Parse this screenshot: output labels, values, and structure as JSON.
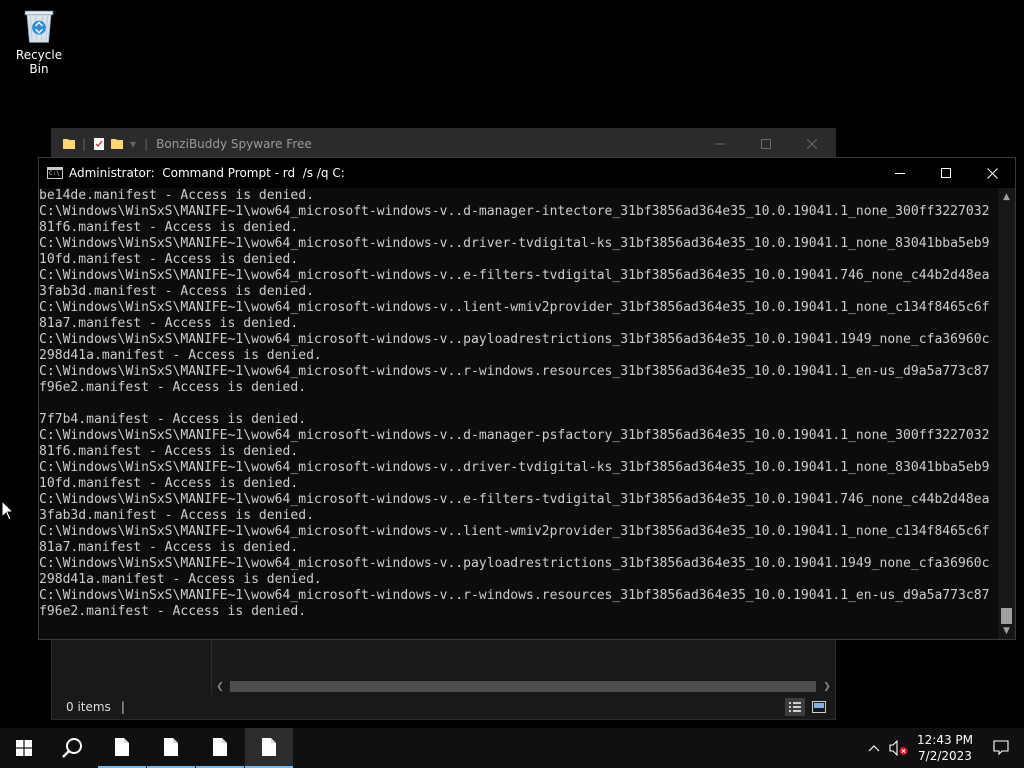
{
  "desktop": {
    "recycle_bin_label": "Recycle Bin"
  },
  "explorer": {
    "title": "BonziBuddy Spyware Free",
    "status_items": "0 items",
    "status_cursor": "|"
  },
  "cmd": {
    "title": "Administrator:  Command Prompt - rd  /s /q C:",
    "lines": [
      "be14de.manifest - Access is denied.",
      "C:\\Windows\\WinSxS\\MANIFE~1\\wow64_microsoft-windows-v..d-manager-intectore_31bf3856ad364e35_10.0.19041.1_none_300ff3227032",
      "81f6.manifest - Access is denied.",
      "C:\\Windows\\WinSxS\\MANIFE~1\\wow64_microsoft-windows-v..driver-tvdigital-ks_31bf3856ad364e35_10.0.19041.1_none_83041bba5eb9",
      "10fd.manifest - Access is denied.",
      "C:\\Windows\\WinSxS\\MANIFE~1\\wow64_microsoft-windows-v..e-filters-tvdigital_31bf3856ad364e35_10.0.19041.746_none_c44b2d48ea",
      "3fab3d.manifest - Access is denied.",
      "C:\\Windows\\WinSxS\\MANIFE~1\\wow64_microsoft-windows-v..lient-wmiv2provider_31bf3856ad364e35_10.0.19041.1_none_c134f8465c6f",
      "81a7.manifest - Access is denied.",
      "C:\\Windows\\WinSxS\\MANIFE~1\\wow64_microsoft-windows-v..payloadrestrictions_31bf3856ad364e35_10.0.19041.1949_none_cfa36960c",
      "298d41a.manifest - Access is denied.",
      "C:\\Windows\\WinSxS\\MANIFE~1\\wow64_microsoft-windows-v..r-windows.resources_31bf3856ad364e35_10.0.19041.1_en-us_d9a5a773c87",
      "f96e2.manifest - Access is denied.",
      "",
      "7f7b4.manifest - Access is denied.",
      "C:\\Windows\\WinSxS\\MANIFE~1\\wow64_microsoft-windows-v..d-manager-psfactory_31bf3856ad364e35_10.0.19041.1_none_300ff3227032",
      "81f6.manifest - Access is denied.",
      "C:\\Windows\\WinSxS\\MANIFE~1\\wow64_microsoft-windows-v..driver-tvdigital-ks_31bf3856ad364e35_10.0.19041.1_none_83041bba5eb9",
      "10fd.manifest - Access is denied.",
      "C:\\Windows\\WinSxS\\MANIFE~1\\wow64_microsoft-windows-v..e-filters-tvdigital_31bf3856ad364e35_10.0.19041.746_none_c44b2d48ea",
      "3fab3d.manifest - Access is denied.",
      "C:\\Windows\\WinSxS\\MANIFE~1\\wow64_microsoft-windows-v..lient-wmiv2provider_31bf3856ad364e35_10.0.19041.1_none_c134f8465c6f",
      "81a7.manifest - Access is denied.",
      "C:\\Windows\\WinSxS\\MANIFE~1\\wow64_microsoft-windows-v..payloadrestrictions_31bf3856ad364e35_10.0.19041.1949_none_cfa36960c",
      "298d41a.manifest - Access is denied.",
      "C:\\Windows\\WinSxS\\MANIFE~1\\wow64_microsoft-windows-v..r-windows.resources_31bf3856ad364e35_10.0.19041.1_en-us_d9a5a773c87",
      "f96e2.manifest - Access is denied."
    ]
  },
  "taskbar": {
    "time": "12:43 PM",
    "date": "7/2/2023",
    "apps": [
      {
        "name": "document-app-1",
        "state": "running"
      },
      {
        "name": "document-app-2",
        "state": "running"
      },
      {
        "name": "document-app-3",
        "state": "running"
      },
      {
        "name": "document-app-4",
        "state": "active"
      }
    ]
  },
  "colors": {
    "console_text": "#cccccc",
    "taskbar_indicator": "#76b9ed",
    "folder_yellow": "#f8d775"
  },
  "icons": {
    "start": "windows-logo-icon",
    "search": "magnifier-icon",
    "tray_chevron": "chevron-up-icon",
    "volume": "volume-muted-icon",
    "notifications": "action-center-icon"
  }
}
